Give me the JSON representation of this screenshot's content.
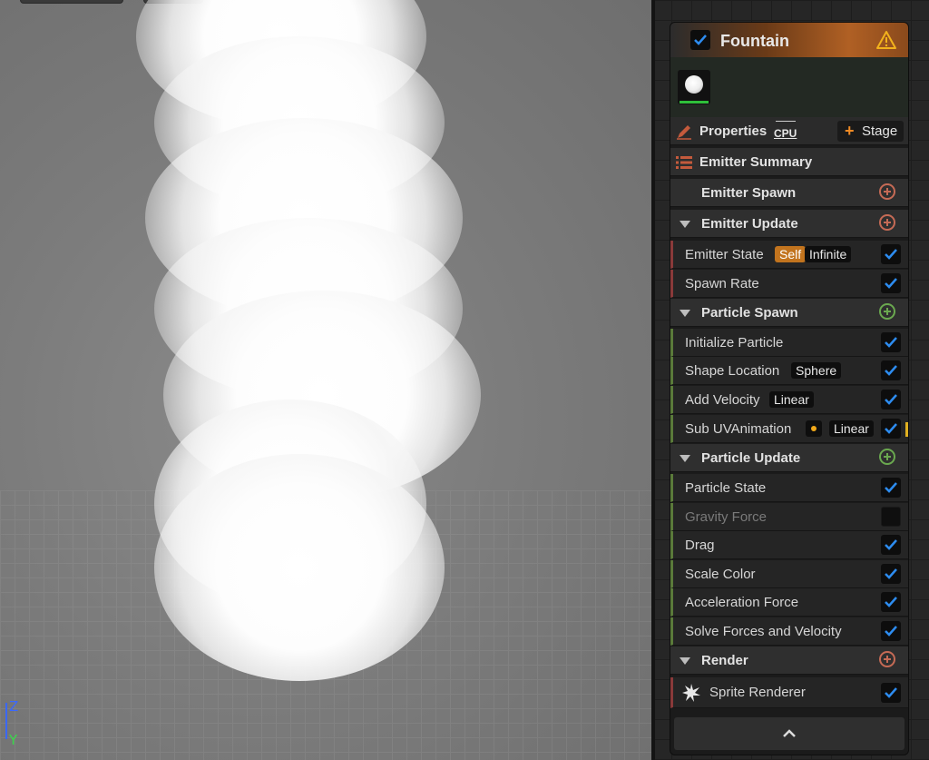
{
  "viewport": {
    "axis_z": "Z",
    "axis_y": "Y"
  },
  "emitter": {
    "title": "Fountain",
    "enabled": true,
    "properties_label": "Properties",
    "sim_target": "CPU",
    "stage_button": "Stage",
    "summary_label": "Emitter Summary",
    "sections": {
      "emitter_spawn": "Emitter Spawn",
      "emitter_update": "Emitter Update",
      "particle_spawn": "Particle Spawn",
      "particle_update": "Particle Update",
      "render": "Render"
    },
    "emitter_update_items": [
      {
        "label": "Emitter State",
        "tags": [
          "Self",
          "Infinite"
        ],
        "enabled": true
      },
      {
        "label": "Spawn Rate",
        "enabled": true
      }
    ],
    "particle_spawn_items": [
      {
        "label": "Initialize Particle",
        "enabled": true
      },
      {
        "label": "Shape Location",
        "tag": "Sphere",
        "enabled": true
      },
      {
        "label": "Add Velocity",
        "tag": "Linear",
        "enabled": true
      },
      {
        "label": "Sub UVAnimation",
        "tag": "Linear",
        "enabled": true
      }
    ],
    "particle_update_items": [
      {
        "label": "Particle State",
        "enabled": true
      },
      {
        "label": "Gravity Force",
        "enabled": false
      },
      {
        "label": "Drag",
        "enabled": true
      },
      {
        "label": "Scale Color",
        "enabled": true
      },
      {
        "label": "Acceleration Force",
        "enabled": true
      },
      {
        "label": "Solve Forces and Velocity",
        "enabled": true
      }
    ],
    "render_items": [
      {
        "label": "Sprite Renderer",
        "enabled": true
      }
    ]
  },
  "colors": {
    "accent_orange": "#c2741e",
    "check_blue": "#2d8cf0",
    "plus_red": "#c56a55",
    "plus_green": "#6aa84f"
  }
}
